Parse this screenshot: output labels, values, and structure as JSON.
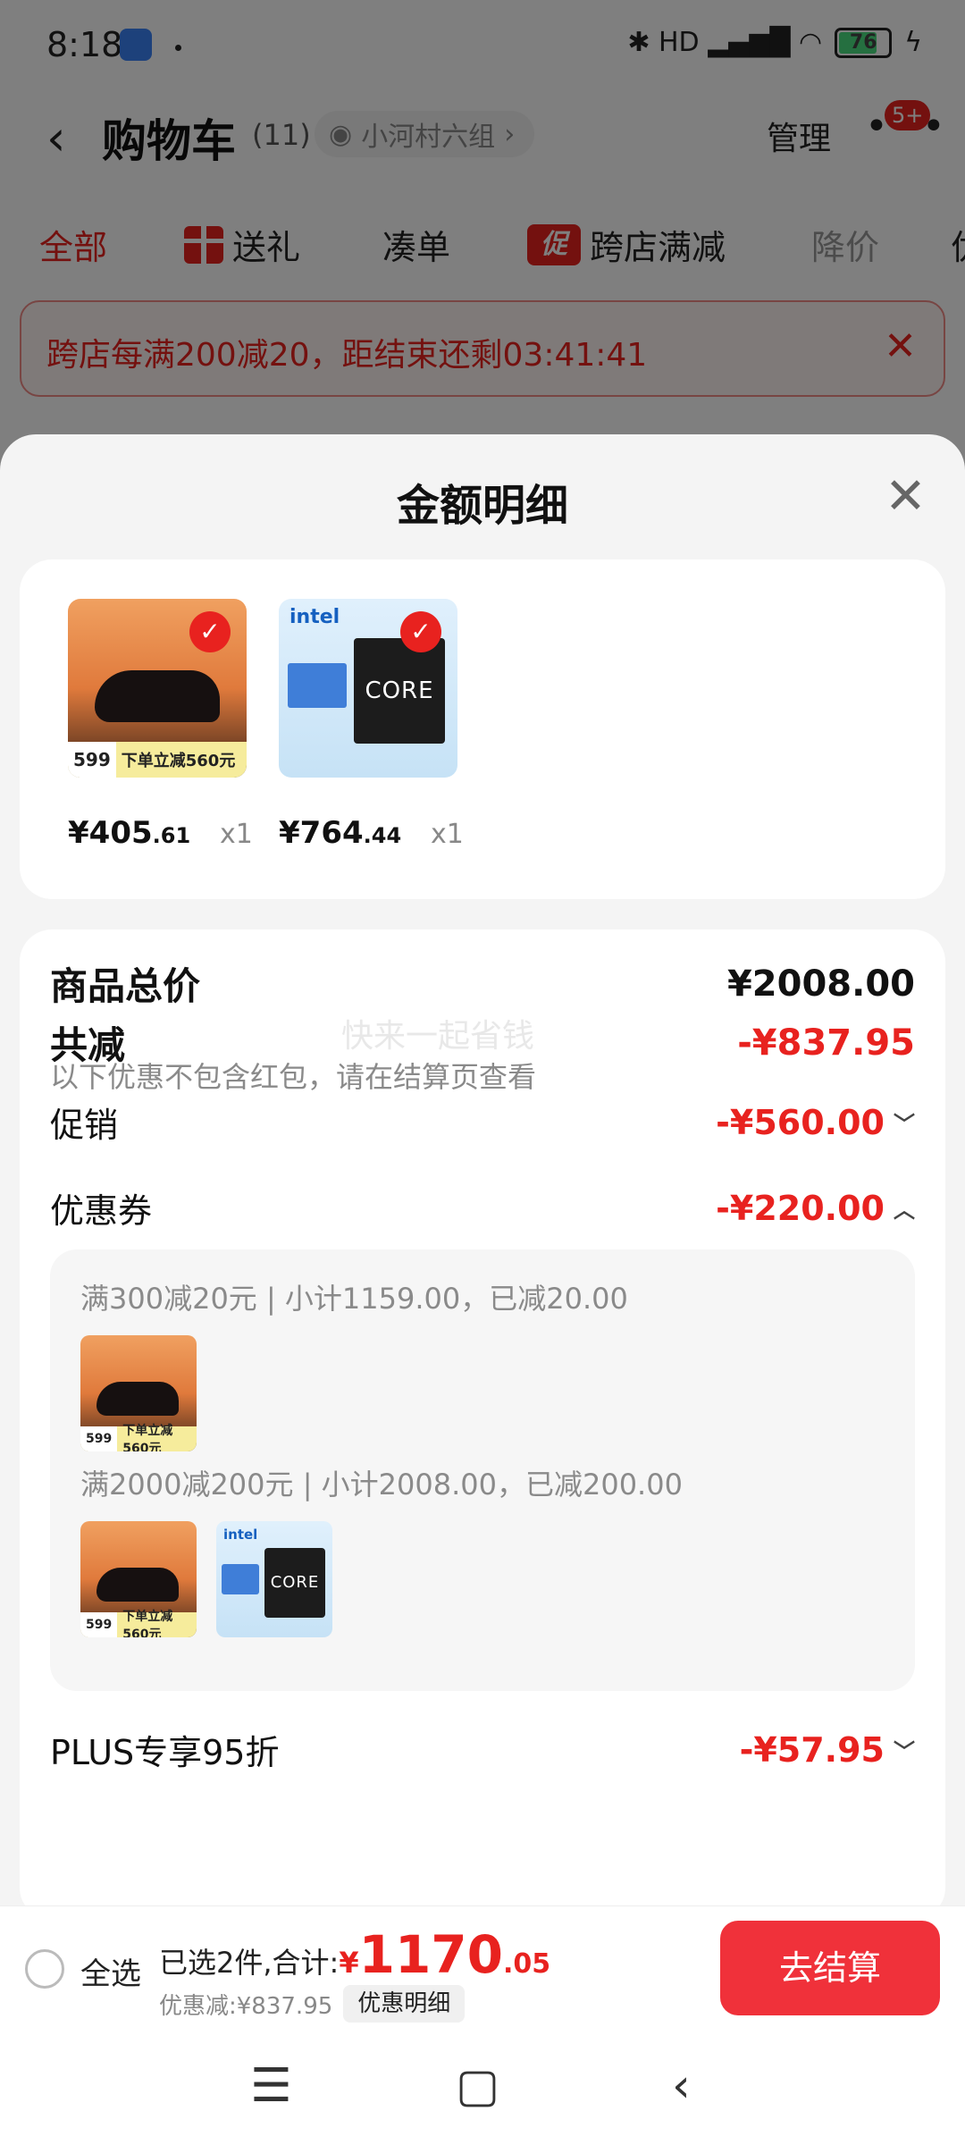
{
  "status_bar": {
    "time": "8:18",
    "battery": "76",
    "signal_glyphs": "✱ HD ▂▄▆█ ◠"
  },
  "header": {
    "back_glyph": "‹",
    "title": "购物车",
    "count": "(11)",
    "group": "小河村六组",
    "group_chevron": "›",
    "manage": "管理",
    "badge": "5+"
  },
  "filters": {
    "all": "全部",
    "gift": "送礼",
    "bundle": "凑单",
    "promo_icon_text": "促",
    "cross_store": "跨店满减",
    "price_drop": "降价",
    "partial": "优"
  },
  "promo_banner": {
    "text": "跨店每满200减20，距结束还剩03:41:41",
    "close": "✕"
  },
  "sheet": {
    "title": "金额明细",
    "close": "✕",
    "products": [
      {
        "name": "shoe",
        "price_int": "¥405",
        "price_dec": ".61",
        "qty": "x1",
        "thumb_price": "599",
        "thumb_label": "下单立减560元"
      },
      {
        "name": "cpu",
        "price_int": "¥764",
        "price_dec": ".44",
        "qty": "x1",
        "thumb_brand": "intel",
        "thumb_box": "CORE"
      }
    ],
    "total_label": "商品总价",
    "total_value": "¥2008.00",
    "watermark": "快来一起省钱",
    "reduce_label": "共减",
    "reduce_value": "-¥837.95",
    "reduce_note": "以下优惠不包含红包，请在结算页查看",
    "promo_label": "促销",
    "promo_value": "-¥560.00",
    "coupon_label": "优惠券",
    "coupon_value": "-¥220.00",
    "coupon_lines": [
      "满300减20元 | 小计1159.00，已减20.00",
      "满2000减200元 | 小计2008.00，已减200.00"
    ],
    "plus_label": "PLUS专享95折",
    "plus_value": "-¥57.95"
  },
  "checkout": {
    "select_all": "全选",
    "summary_label": "已选2件,合计:",
    "currency": "¥",
    "amount_int": "1170",
    "amount_dec": ".05",
    "discount_text": "优惠减:¥837.95",
    "detail_chip": "优惠明细",
    "button": "去结算"
  },
  "gestures": {
    "menu": "☰",
    "home": "▢",
    "back": "‹"
  },
  "colors": {
    "accent": "#e8221f",
    "checkout_button": "#f0313a"
  }
}
